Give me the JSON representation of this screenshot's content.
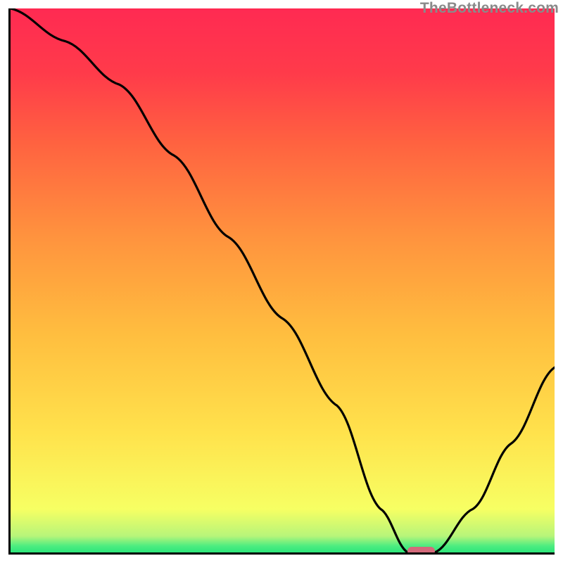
{
  "watermark": "TheBottleneck.com",
  "chart_data": {
    "type": "line",
    "title": "",
    "xlabel": "",
    "ylabel": "",
    "xlim": [
      0,
      100
    ],
    "ylim": [
      0,
      100
    ],
    "grid": false,
    "legend": false,
    "x": [
      0,
      10,
      20,
      30,
      40,
      50,
      60,
      68,
      73,
      78,
      85,
      92,
      100
    ],
    "values": [
      100,
      94,
      86,
      73,
      58,
      43,
      27,
      8,
      0,
      0,
      8,
      20,
      34
    ],
    "marker": {
      "x_start": 73,
      "x_end": 78,
      "y": 0
    },
    "background_gradient": {
      "direction": "bottom-to-top",
      "stops": [
        {
          "pos": 0.0,
          "color": "#2ce57a"
        },
        {
          "pos": 0.03,
          "color": "#b7f57a"
        },
        {
          "pos": 0.08,
          "color": "#f7ff63"
        },
        {
          "pos": 0.4,
          "color": "#ffbe3f"
        },
        {
          "pos": 0.75,
          "color": "#ff6340"
        },
        {
          "pos": 1.0,
          "color": "#ff2a52"
        }
      ]
    }
  },
  "colors": {
    "line": "#000000",
    "marker": "#d46a7b",
    "axis": "#000000",
    "watermark": "#8a8a8a"
  }
}
